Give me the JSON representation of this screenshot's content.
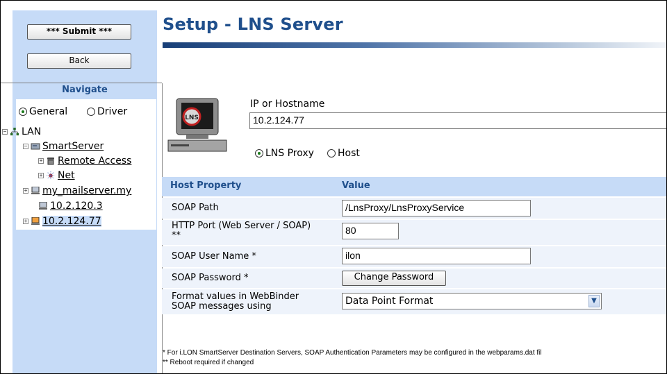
{
  "page": {
    "title": "Setup - LNS Server",
    "colors": {
      "accent": "#1f4f8c",
      "panel": "#c6dbf7",
      "row": "#eef3fb"
    }
  },
  "actions": {
    "submit_label": "*** Submit ***",
    "back_label": "Back"
  },
  "nav": {
    "heading": "Navigate",
    "mode_options": [
      {
        "label": "General",
        "selected": true
      },
      {
        "label": "Driver",
        "selected": false
      }
    ],
    "tree": {
      "root": {
        "label": "LAN",
        "icon": "network-icon"
      },
      "smartserver": {
        "label": "SmartServer",
        "icon": "server-icon"
      },
      "remote_access": {
        "label": "Remote Access",
        "icon": "phone-icon"
      },
      "net": {
        "label": "Net",
        "icon": "net-icon"
      },
      "mail": {
        "label": "my_mailserver.my",
        "icon": "computer-icon"
      },
      "ip1": {
        "label": "10.2.120.3",
        "icon": "computer-icon"
      },
      "ip2": {
        "label": "10.2.124.77",
        "icon": "computer-icon"
      }
    }
  },
  "main": {
    "lns_logo_text": "LNS",
    "ip_label": "IP or Hostname",
    "ip_value": "10.2.124.77",
    "type_options": [
      {
        "label": "LNS Proxy",
        "selected": true
      },
      {
        "label": "Host",
        "selected": false
      }
    ],
    "table": {
      "col_property": "Host Property",
      "col_value": "Value",
      "soap_path": {
        "label": "SOAP Path",
        "value": "/LnsProxy/LnsProxyService"
      },
      "http_port": {
        "label_line1": "HTTP Port (Web Server / SOAP)",
        "label_line2": "**",
        "value": "80"
      },
      "soap_user": {
        "label": "SOAP User Name *",
        "value": "ilon"
      },
      "soap_password": {
        "label": "SOAP Password *",
        "button": "Change Password"
      },
      "format": {
        "label_line1": "Format values in WebBinder",
        "label_line2": "SOAP messages using",
        "value": "Data Point Format"
      }
    },
    "footnote1": "* For i.LON SmartServer Destination Servers, SOAP Authentication Parameters may be configured in the webparams.dat fil",
    "footnote2": "** Reboot required if changed"
  }
}
